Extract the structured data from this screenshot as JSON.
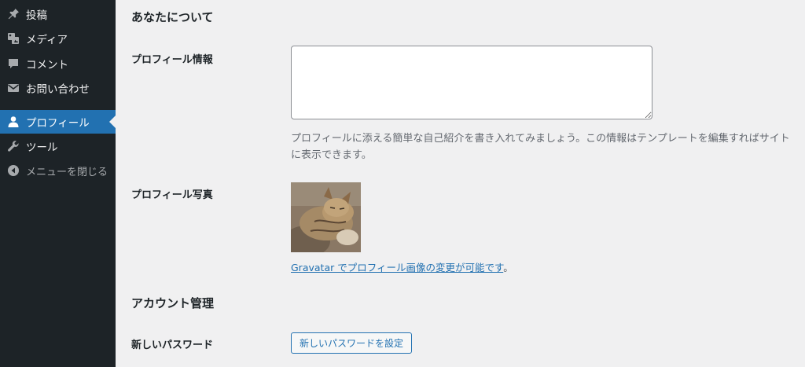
{
  "sidebar": {
    "items": [
      {
        "label": "投稿",
        "icon": "pin-icon"
      },
      {
        "label": "メディア",
        "icon": "media-icon"
      },
      {
        "label": "コメント",
        "icon": "comment-icon"
      },
      {
        "label": "お問い合わせ",
        "icon": "mail-icon"
      },
      {
        "label": "プロフィール",
        "icon": "user-icon",
        "active": true
      },
      {
        "label": "ツール",
        "icon": "wrench-icon"
      },
      {
        "label": "メニューを閉じる",
        "icon": "collapse-icon"
      }
    ],
    "colors": {
      "background": "#1d2327",
      "active": "#2271b1",
      "text": "#f0f0f1"
    }
  },
  "about_section": {
    "title": "あなたについて",
    "bio_label": "プロフィール情報",
    "bio_value": "",
    "bio_description": "プロフィールに添える簡単な自己紹介を書き入れてみましょう。この情報はテンプレートを編集すればサイトに表示できます。",
    "photo_label": "プロフィール写真",
    "gravatar_link": "Gravatar でプロフィール画像の変更が可能です",
    "gravatar_suffix": "。"
  },
  "account_section": {
    "title": "アカウント管理",
    "password_label": "新しいパスワード",
    "password_button": "新しいパスワードを設定"
  }
}
